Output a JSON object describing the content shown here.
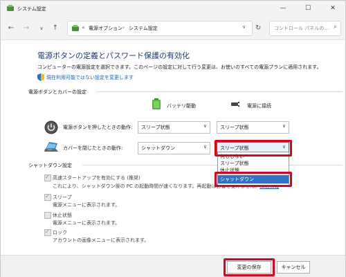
{
  "window": {
    "title": "システム設定"
  },
  "address": {
    "overflow": "«",
    "crumbs": [
      "電源オプション",
      "システム設定"
    ],
    "search_placeholder": "コントロール パネルの..."
  },
  "page": {
    "heading": "電源ボタンの定義とパスワード保護の有効化",
    "description": "コンピューターの電源設定を選択できます。このページの設定に対して行う変更は、お使いのすべての電源プランに適用されます。",
    "unavailable_link": "現在利用可能ではない設定を変更します"
  },
  "buttons_section": {
    "title": "電源ボタンとカバーの設定",
    "col_battery": "バッテリ駆動",
    "col_plugged": "電源に接続",
    "rows": [
      {
        "label": "電源ボタンを押したときの動作:",
        "battery": "スリープ状態",
        "plugged": "スリープ状態"
      },
      {
        "label": "カバーを閉じたときの動作:",
        "battery": "シャットダウン",
        "plugged": "スリープ状態"
      }
    ],
    "dropdown_options": [
      "何もしない",
      "スリープ状態",
      "休止状態",
      "シャットダウン"
    ],
    "dropdown_highlighted": "シャットダウン"
  },
  "shutdown_section": {
    "title": "シャットダウン設定",
    "options": [
      {
        "label": "高速スタートアップを有効にする (推奨)",
        "sub": "これにより、シャットダウン後の PC の起動時間が速くなります。再起動は影響を受けません。",
        "link": "詳細情報",
        "checked": true
      },
      {
        "label": "スリープ",
        "sub": "電源メニューに表示されます。",
        "checked": true
      },
      {
        "label": "休止状態",
        "sub": "電源メニューに表示されます。",
        "checked": false
      },
      {
        "label": "ロック",
        "sub": "アカウントの画像メニューに表示されます。",
        "checked": true
      }
    ]
  },
  "footer": {
    "save": "変更の保存",
    "cancel": "キャンセル"
  },
  "colors": {
    "heading": "#1f3a6e",
    "link": "#1a5fb4",
    "highlight": "#e0001b",
    "selection": "#2f71c8"
  }
}
